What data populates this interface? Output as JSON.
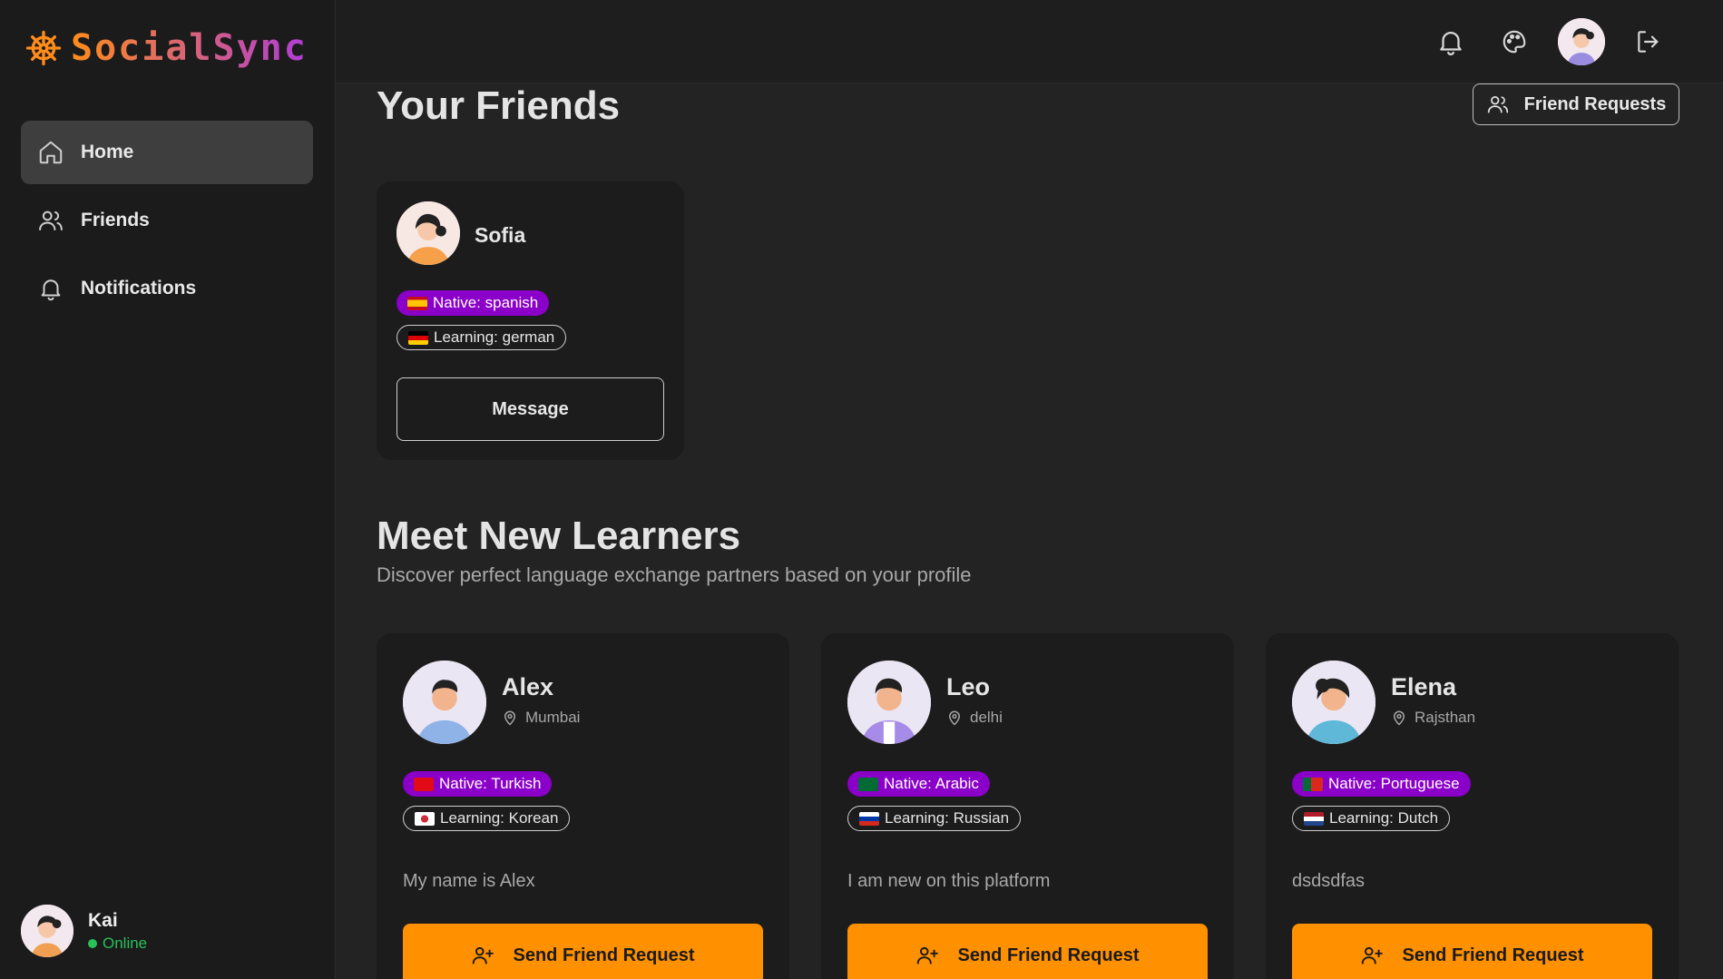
{
  "app": {
    "name": "SocialSync",
    "logo_icon": "ship-wheel-icon"
  },
  "sidebar": {
    "items": [
      {
        "label": "Home",
        "icon": "home-icon",
        "active": true
      },
      {
        "label": "Friends",
        "icon": "users-icon",
        "active": false
      },
      {
        "label": "Notifications",
        "icon": "bell-icon",
        "active": false
      }
    ],
    "user": {
      "name": "Kai",
      "status": "Online"
    }
  },
  "topbar": {
    "icons": [
      "bell-icon",
      "palette-icon",
      "avatar",
      "logout-icon"
    ]
  },
  "friends_section": {
    "title": "Your Friends",
    "requests_button": "Friend Requests",
    "friends": [
      {
        "name": "Sofia",
        "native": "Native: spanish",
        "learning": "Learning: german",
        "message_label": "Message"
      }
    ]
  },
  "learners_section": {
    "title": "Meet New Learners",
    "subtitle": "Discover perfect language exchange partners based on your profile",
    "learners": [
      {
        "name": "Alex",
        "location": "Mumbai",
        "native": "Native: Turkish",
        "learning": "Learning: Korean",
        "bio": "My name is Alex",
        "button": "Send Friend Request"
      },
      {
        "name": "Leo",
        "location": "delhi",
        "native": "Native: Arabic",
        "learning": "Learning: Russian",
        "bio": "I am new on this platform",
        "button": "Send Friend Request"
      },
      {
        "name": "Elena",
        "location": "Rajsthan",
        "native": "Native: Portuguese",
        "learning": "Learning: Dutch",
        "bio": "dsdsdfas",
        "button": "Send Friend Request"
      }
    ]
  },
  "colors": {
    "accent": "#ff9000",
    "native_pill": "#8a00c8",
    "online": "#27c15a"
  }
}
